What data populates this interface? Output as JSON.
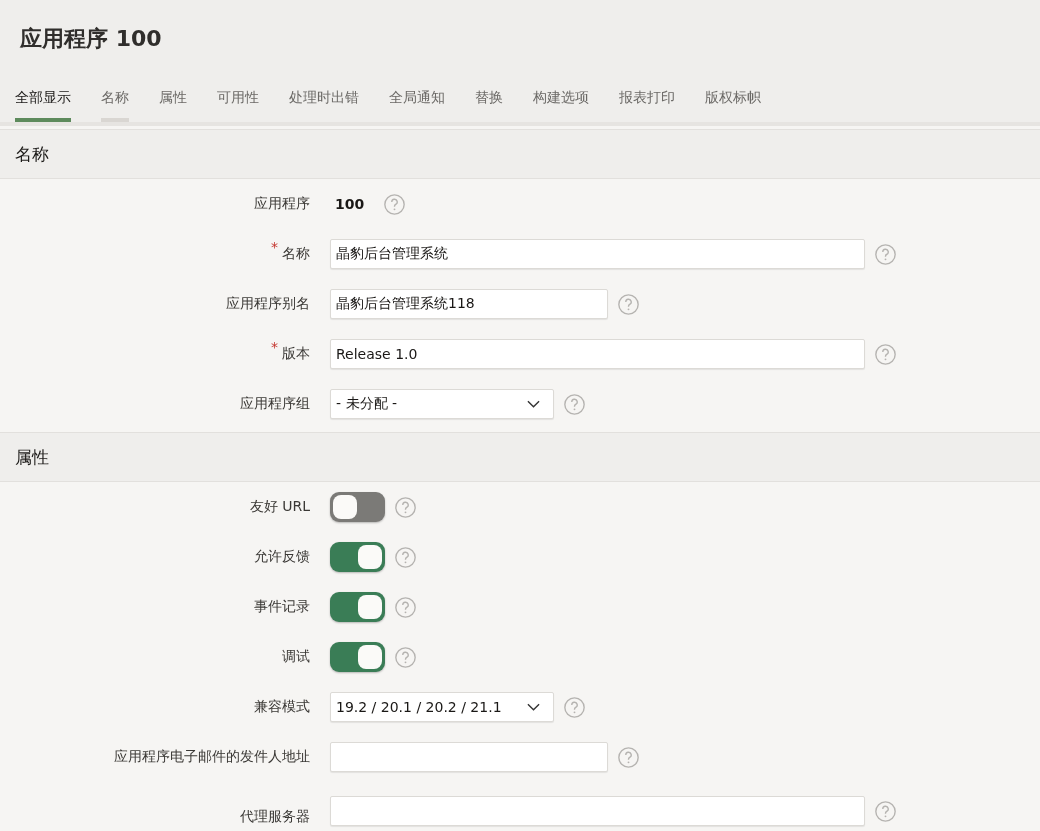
{
  "page_title": "应用程序 100",
  "tabs": [
    {
      "label": "全部显示",
      "selected": true,
      "highlighted": false
    },
    {
      "label": "名称",
      "selected": false,
      "highlighted": true
    },
    {
      "label": "属性",
      "selected": false,
      "highlighted": false
    },
    {
      "label": "可用性",
      "selected": false,
      "highlighted": false
    },
    {
      "label": "处理时出错",
      "selected": false,
      "highlighted": false
    },
    {
      "label": "全局通知",
      "selected": false,
      "highlighted": false
    },
    {
      "label": "替换",
      "selected": false,
      "highlighted": false
    },
    {
      "label": "构建选项",
      "selected": false,
      "highlighted": false
    },
    {
      "label": "报表打印",
      "selected": false,
      "highlighted": false
    },
    {
      "label": "版权标帜",
      "selected": false,
      "highlighted": false
    }
  ],
  "sections": [
    {
      "title": "名称",
      "fields": [
        {
          "kind": "display",
          "label": "应用程序",
          "value": "100"
        },
        {
          "kind": "wide_input",
          "label": "名称",
          "value": "晶豹后台管理系统",
          "required_mark": "*"
        },
        {
          "kind": "short_input",
          "label": "应用程序别名",
          "value": "晶豹后台管理系统118"
        },
        {
          "kind": "wide_input",
          "label": "版本",
          "value": "Release 1.0",
          "required_mark": "*"
        },
        {
          "kind": "select",
          "label": "应用程序组",
          "value": "- 未分配 -"
        }
      ]
    },
    {
      "title": "属性",
      "fields": [
        {
          "kind": "switch",
          "label": "友好 URL",
          "on": false
        },
        {
          "kind": "switch",
          "label": "允许反馈",
          "on": true
        },
        {
          "kind": "switch",
          "label": "事件记录",
          "on": true
        },
        {
          "kind": "switch",
          "label": "调试",
          "on": true
        },
        {
          "kind": "select",
          "label": "兼容模式",
          "value": "19.2 / 20.1 / 20.2 / 21.1"
        },
        {
          "kind": "short_input",
          "label": "应用程序电子邮件的发件人地址"
        },
        {
          "kind": "wide_input",
          "label": "代理服务器"
        }
      ]
    }
  ]
}
